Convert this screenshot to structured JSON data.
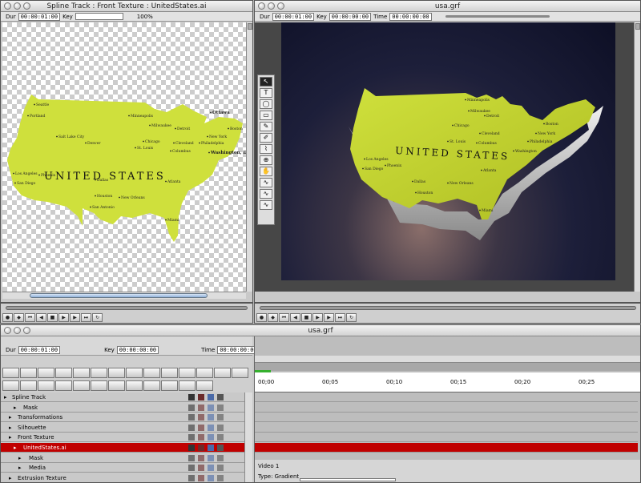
{
  "colors": {
    "map_fill": "#cfe03c",
    "selection_red": "#c00000",
    "dark_panel": "#474747",
    "stage_bg": "#12132c"
  },
  "left_window": {
    "title": "Spline Track : Front Texture : UnitedStates.ai",
    "dur_label": "Dur",
    "dur_value": "00:00:01:00",
    "key_label": "Key",
    "zoom": "100%",
    "map": {
      "country": "UNITED STATES",
      "cities": [
        "Seattle",
        "Portland",
        "Salt Lake City",
        "Denver",
        "Minneapolis",
        "Milwaukee",
        "Chicago",
        "Detroit",
        "Cleveland",
        "Columbus",
        "St. Louis",
        "Ottawa",
        "Boston",
        "New York",
        "Philadelphia",
        "Washington, D.C.",
        "Los Angeles",
        "San Diego",
        "Phoenix",
        "Dallas",
        "Houston",
        "San Antonio",
        "New Orleans",
        "Atlanta",
        "Miami"
      ]
    }
  },
  "right_window": {
    "title": "usa.grf",
    "dur_label": "Dur",
    "dur_value": "00:00:01:00",
    "key_label": "Key",
    "key_value": "00:00:00:00",
    "time_label": "Time",
    "time_value": "00:00:00:00",
    "zoom": "100%",
    "map": {
      "country": "UNITED STATES",
      "cities": [
        "Minneapolis",
        "Milwaukee",
        "Chicago",
        "Detroit",
        "Cleveland",
        "Columbus",
        "St. Louis",
        "Boston",
        "New York",
        "Philadelphia",
        "Washington",
        "Los Angeles",
        "San Diego",
        "Phoenix",
        "Dallas",
        "Houston",
        "New Orleans",
        "Atlanta",
        "Miami"
      ]
    },
    "tools": [
      "pointer-tool",
      "text-tool",
      "ellipse-tool",
      "rect-tool",
      "pen-tool",
      "brush-tool",
      "eyedropper-tool",
      "zoom-tool",
      "hand-tool",
      "curve-tool-1",
      "curve-tool-2",
      "curve-tool-3"
    ]
  },
  "timeline_window": {
    "title": "usa.grf",
    "dur_label": "Dur",
    "dur_value": "00:00:01:00",
    "key_label": "Key",
    "key_value": "00:00:00:00",
    "time_label": "Time",
    "time_value": "00:00:00:00",
    "ruler": [
      "00;00",
      "00;05",
      "00;10",
      "00;15",
      "00;20",
      "00;25"
    ],
    "tracks": [
      {
        "label": "Spline Track",
        "indent": 0,
        "selected": false
      },
      {
        "label": "Mask",
        "indent": 2,
        "selected": false
      },
      {
        "label": "Transformations",
        "indent": 1,
        "selected": false
      },
      {
        "label": "Silhouette",
        "indent": 1,
        "selected": false
      },
      {
        "label": "Front Texture",
        "indent": 1,
        "selected": false
      },
      {
        "label": "UnitedStates.ai",
        "indent": 2,
        "selected": true
      },
      {
        "label": "Mask",
        "indent": 3,
        "selected": false
      },
      {
        "label": "Media",
        "indent": 3,
        "selected": false
      },
      {
        "label": "Extrusion Texture",
        "indent": 1,
        "selected": false
      }
    ],
    "info": {
      "video_label": "Video 1",
      "type_label": "Type: Gradient"
    }
  }
}
